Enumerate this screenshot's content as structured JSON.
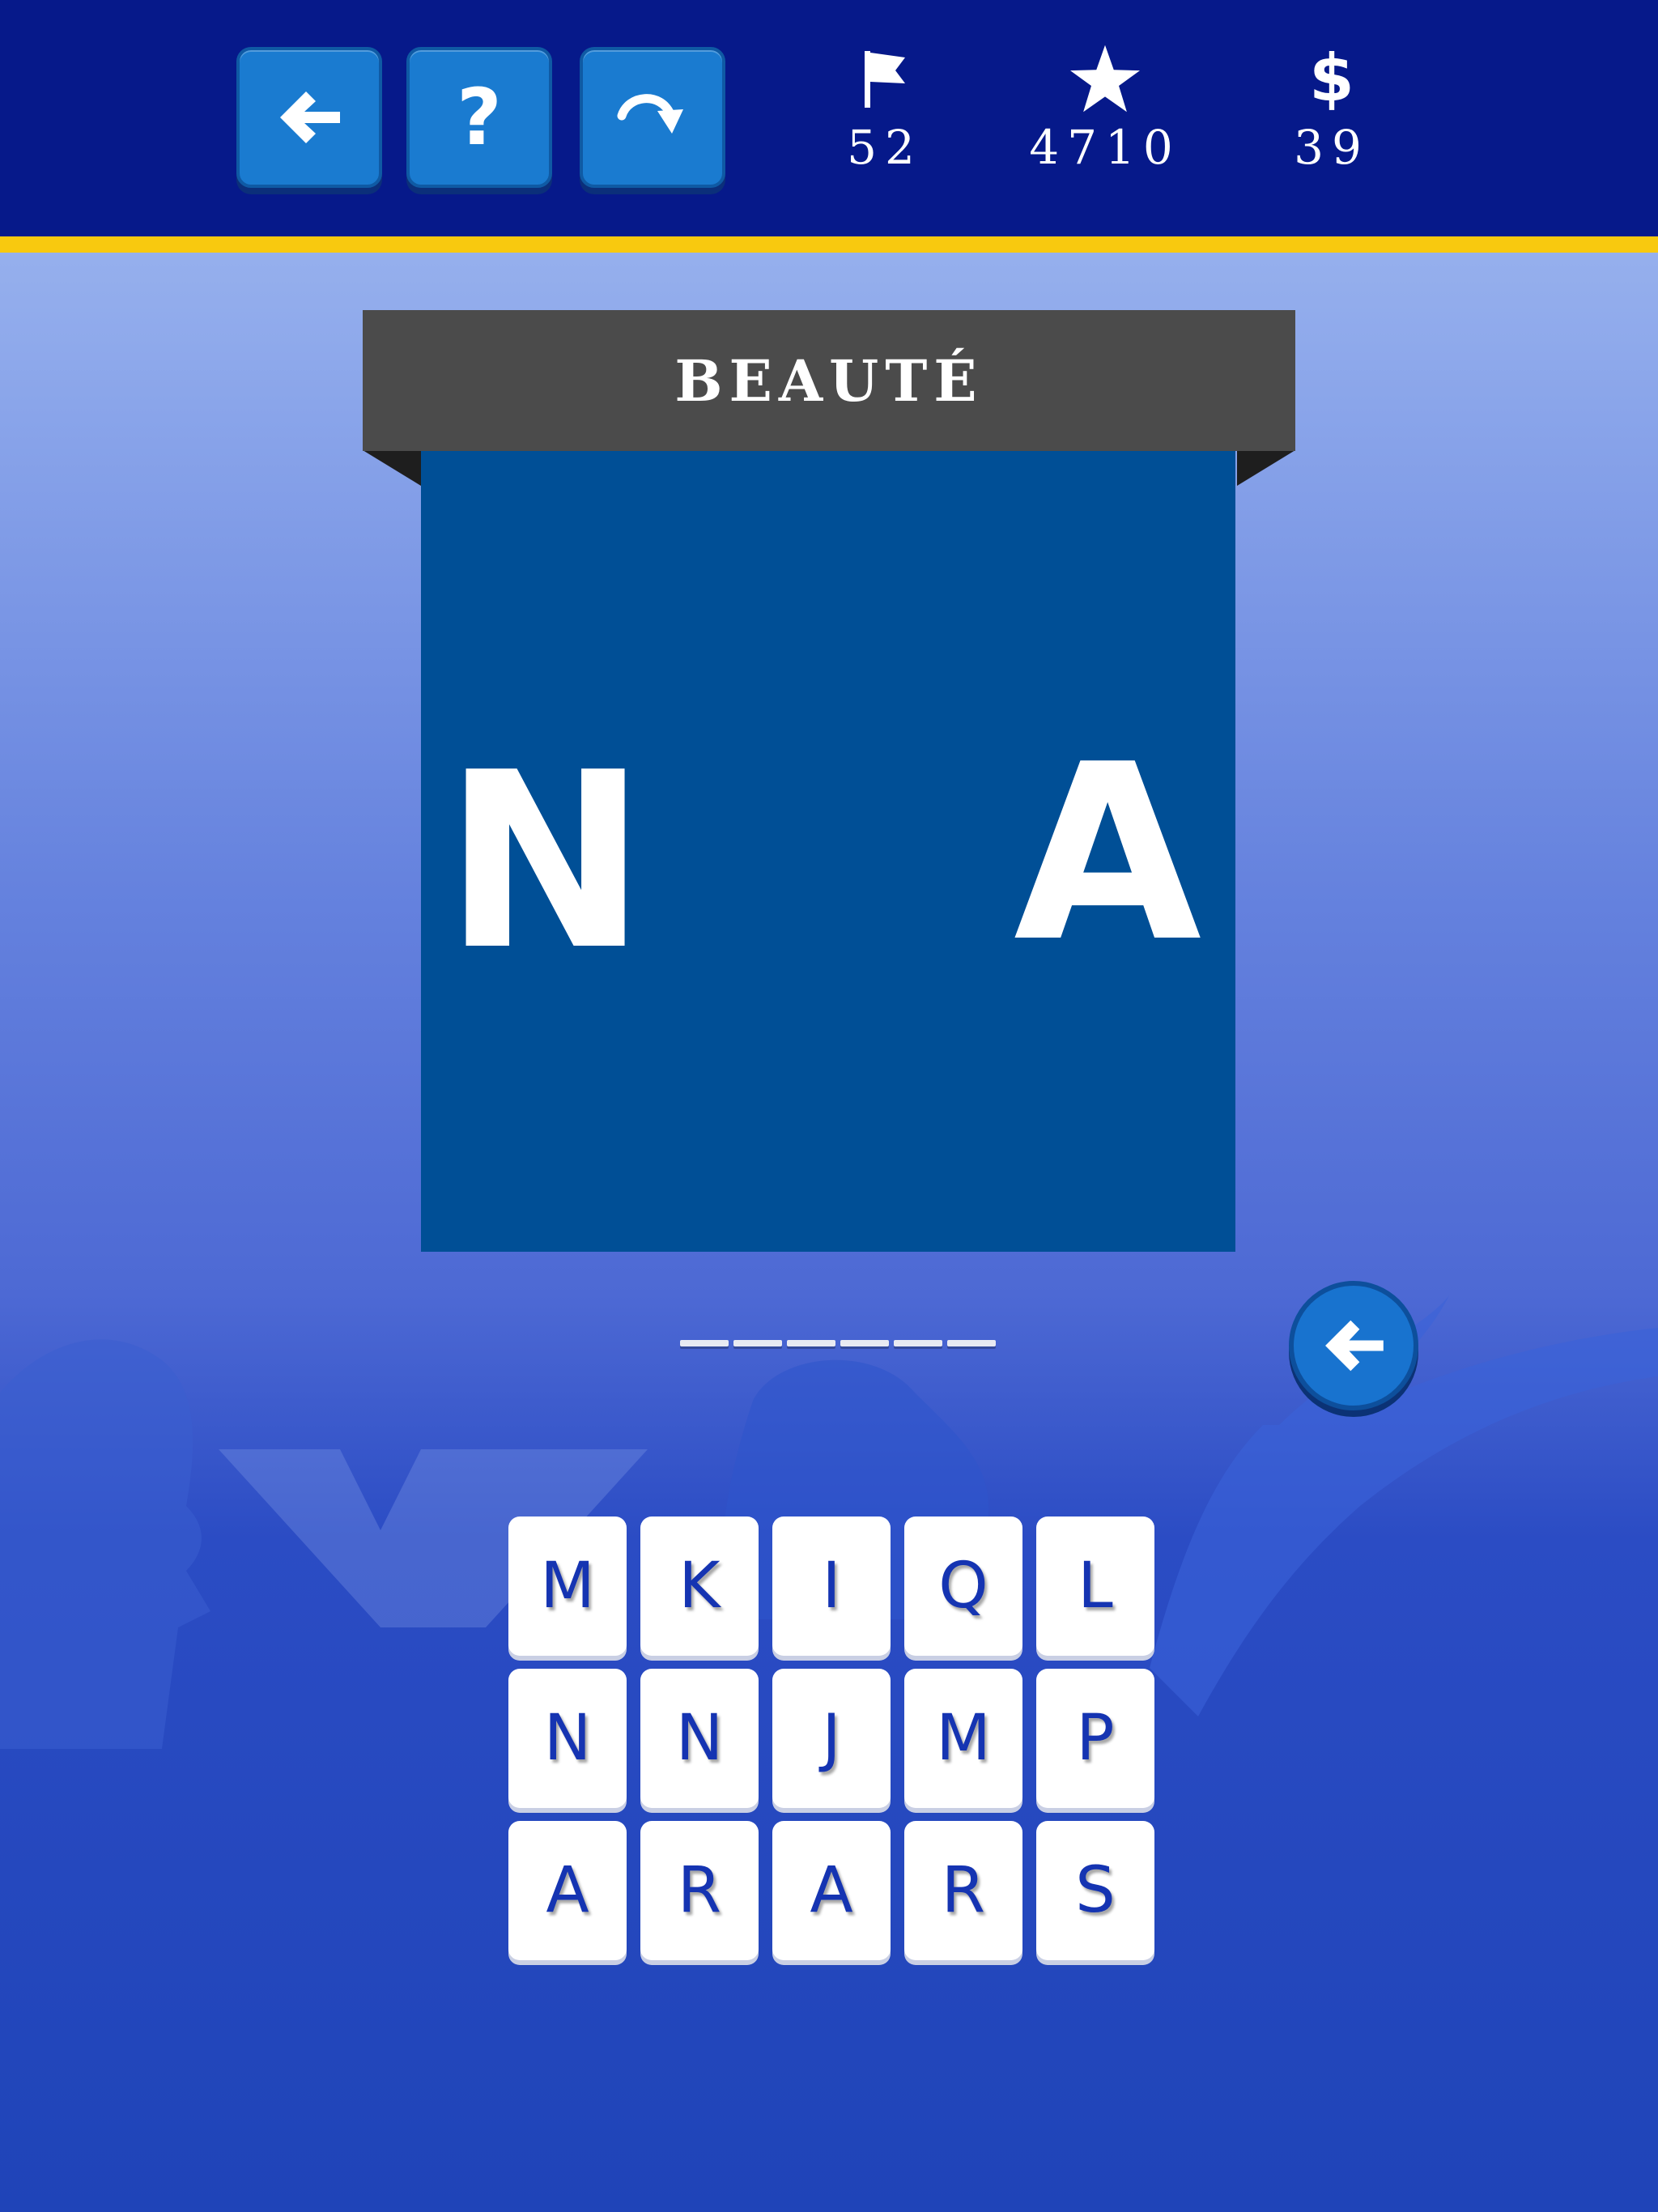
{
  "toolbar": {
    "back_icon": "arrow-left-icon",
    "hint_label": "?",
    "skip_icon": "curved-arrow-icon"
  },
  "stats": {
    "levels": {
      "icon": "flag-icon",
      "value": "52"
    },
    "stars": {
      "icon": "star-icon",
      "value": "4710"
    },
    "coins": {
      "icon": "dollar-icon",
      "symbol": "$",
      "value": "39"
    }
  },
  "puzzle": {
    "category": "BEAUTÉ",
    "logo_letters": [
      "N",
      "A"
    ],
    "answer_slot_count": 6
  },
  "keyboard": {
    "keys": [
      "M",
      "K",
      "I",
      "Q",
      "L",
      "N",
      "N",
      "J",
      "M",
      "P",
      "A",
      "R",
      "A",
      "R",
      "S"
    ]
  },
  "colors": {
    "topbar": "#06198a",
    "accent_stripe": "#f8c90f",
    "button_blue": "#1a7bd0",
    "logo_background": "#004f96",
    "banner": "#4b4b4b",
    "key_text": "#1534b2"
  }
}
